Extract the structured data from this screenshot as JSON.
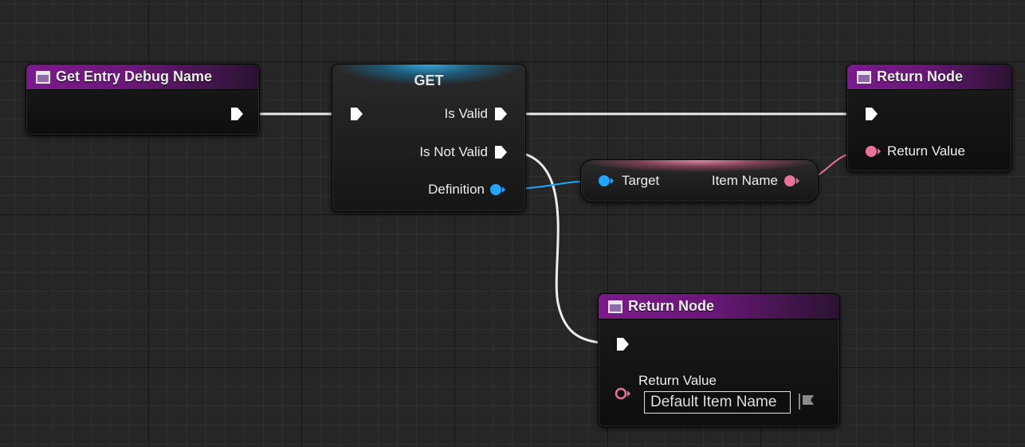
{
  "colors": {
    "exec_wire": "#ececec",
    "struct_pin": "#1ea7ff",
    "name_pin": "#e8739a",
    "function_header": "#7b1a8c"
  },
  "nodes": {
    "entry": {
      "title": "Get Entry Debug Name",
      "icon": "function-icon"
    },
    "get": {
      "title": "GET",
      "is_valid_label": "Is Valid",
      "is_not_valid_label": "Is Not Valid",
      "definition_label": "Definition"
    },
    "item_name": {
      "target_label": "Target",
      "item_name_label": "Item Name"
    },
    "return_top": {
      "title": "Return Node",
      "icon": "function-icon",
      "return_value_label": "Return Value"
    },
    "return_bottom": {
      "title": "Return Node",
      "icon": "function-icon",
      "return_value_label": "Return Value",
      "default_value": "Default Item Name",
      "flag_icon": "flag-icon"
    }
  }
}
